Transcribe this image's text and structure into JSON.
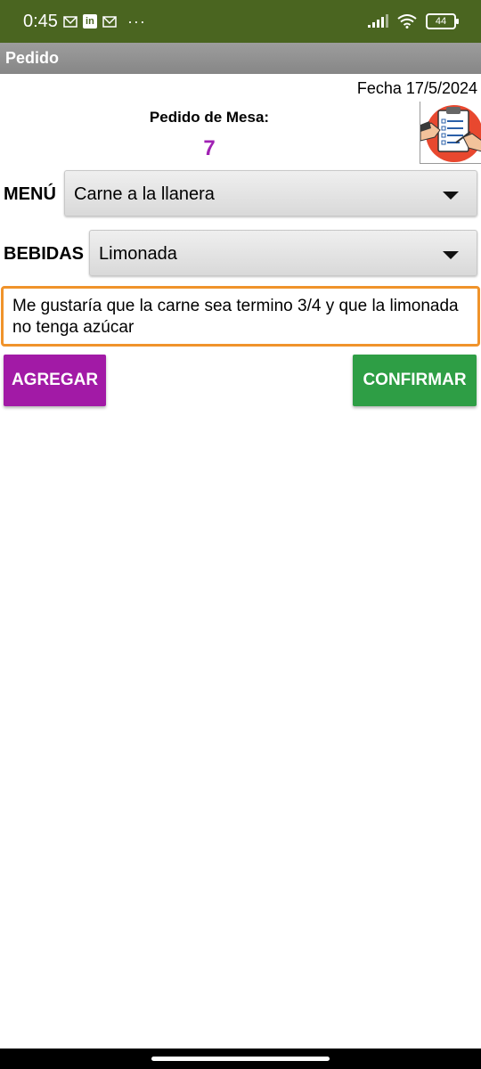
{
  "status_bar": {
    "time": "0:45",
    "icons": [
      "mail-icon",
      "linkedin-icon",
      "mail-icon",
      "more-icon",
      "signal-icon",
      "wifi-icon",
      "battery-icon"
    ],
    "linkedin_glyph": "in",
    "more_glyph": "···",
    "battery": "44",
    "background": "#4a6520"
  },
  "app_bar": {
    "title": "Pedido"
  },
  "header": {
    "fecha": "Fecha 17/5/2024",
    "mesa_label": "Pedido de Mesa:",
    "mesa_number": "7",
    "mesa_number_color": "#a021b3",
    "image_icon": "clipboard-checklist-icon"
  },
  "menu": {
    "label": "MENÚ",
    "selected": "Carne a la llanera"
  },
  "bebidas": {
    "label": "BEBIDAS",
    "selected": "Limonada"
  },
  "note": {
    "value": "Me gustaría que la carne sea termino 3/4 y que la limonada no tenga azúcar",
    "border_color": "#f0932b"
  },
  "buttons": {
    "agregar": "AGREGAR",
    "agregar_color": "#a21aa6",
    "confirmar": "CONFIRMAR",
    "confirmar_color": "#2e9e45"
  }
}
